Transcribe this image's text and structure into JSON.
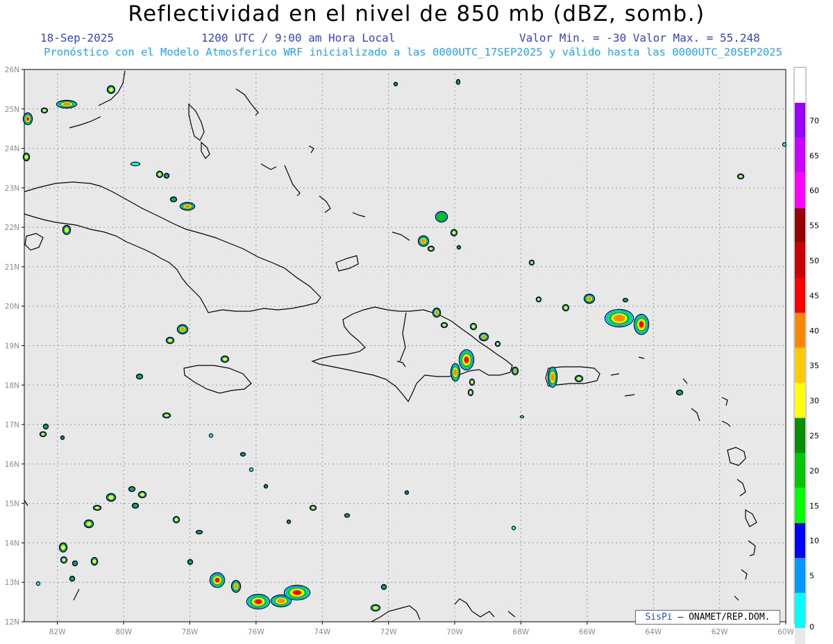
{
  "header": {
    "title": "Reflectividad en el nivel de 850 mb (dBZ, somb.)",
    "date": "18-Sep-2025",
    "time": "1200 UTC / 9:00 am Hora Local",
    "minmax": "Valor Min. = -30  Valor Max. = 55.248",
    "model_info": "Pronóstico con el Modelo Atmosferico WRF inicializado a las 0000UTC_17SEP2025 y válido hasta las  0000UTC_20SEP2025"
  },
  "map": {
    "lon_range": [
      -83,
      -60
    ],
    "lat_range": [
      12,
      26
    ],
    "background": "#e8e8e8",
    "lat_labels": [
      "26N",
      "25N",
      "24N",
      "23N",
      "22N",
      "21N",
      "20N",
      "19N",
      "18N",
      "17N",
      "16N",
      "15N",
      "14N",
      "13N",
      "12N"
    ],
    "lon_labels": [
      "82W",
      "80W",
      "78W",
      "76W",
      "74W",
      "72W",
      "70W",
      "68W",
      "66W",
      "64W",
      "62W",
      "60W"
    ]
  },
  "colorbar": {
    "labels": [
      "0",
      "5",
      "10",
      "15",
      "20",
      "25",
      "30",
      "35",
      "40",
      "45",
      "50",
      "55",
      "60",
      "65",
      "70"
    ],
    "colors": [
      "#00ffff",
      "#0099ff",
      "#0000ff",
      "#00ff00",
      "#00c800",
      "#009000",
      "#ffff00",
      "#ffcc00",
      "#ff8800",
      "#ff0000",
      "#cc0000",
      "#990000",
      "#ff00ff",
      "#cc00ff",
      "#9900ff"
    ]
  },
  "credit": {
    "brand": "SisPi",
    "org": "– ONAMET/REP.DOM."
  }
}
